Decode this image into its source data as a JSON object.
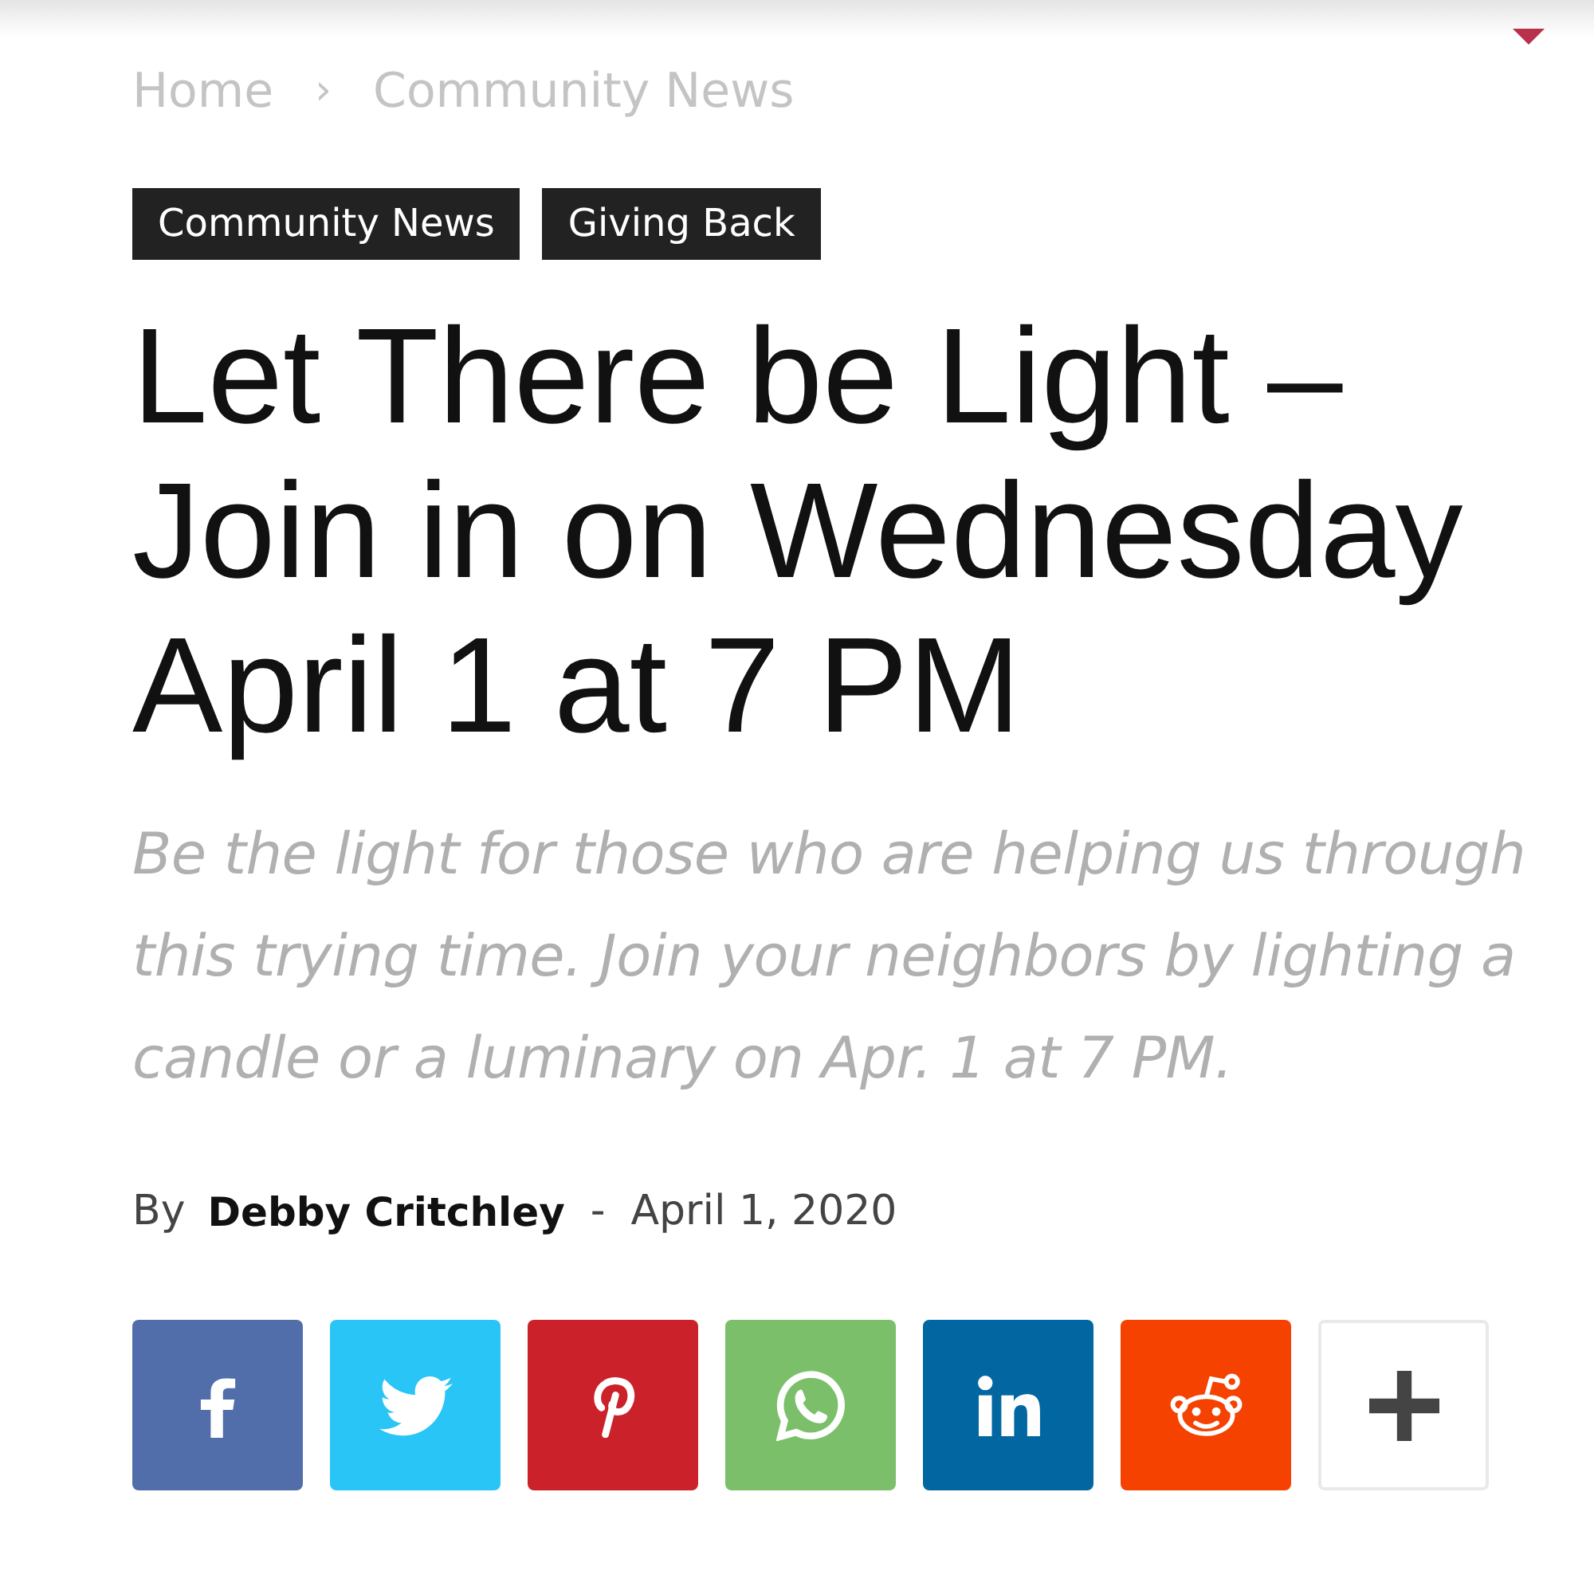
{
  "breadcrumb": {
    "items": [
      "Home",
      "Community News"
    ],
    "separator": "›"
  },
  "tags": [
    "Community News",
    "Giving Back"
  ],
  "title": "Let There be Light – Join in on Wednesday April 1 at 7 PM",
  "excerpt": "Be the light for those who are helping us through this trying time. Join your neighbors by lighting a candle or a luminary on Apr. 1 at 7 PM.",
  "byline": {
    "prefix": "By",
    "author": "Debby Critchley",
    "separator": "-",
    "date": "April 1, 2020"
  },
  "share_buttons": [
    {
      "kind": "facebook",
      "color": "#516eab"
    },
    {
      "kind": "twitter",
      "color": "#29c5f6"
    },
    {
      "kind": "pinterest",
      "color": "#ca212a"
    },
    {
      "kind": "whatsapp",
      "color": "#7bbf6a"
    },
    {
      "kind": "linkedin",
      "color": "#0266a0"
    },
    {
      "kind": "reddit",
      "color": "#f54200"
    },
    {
      "kind": "more",
      "color": "#ffffff"
    }
  ]
}
